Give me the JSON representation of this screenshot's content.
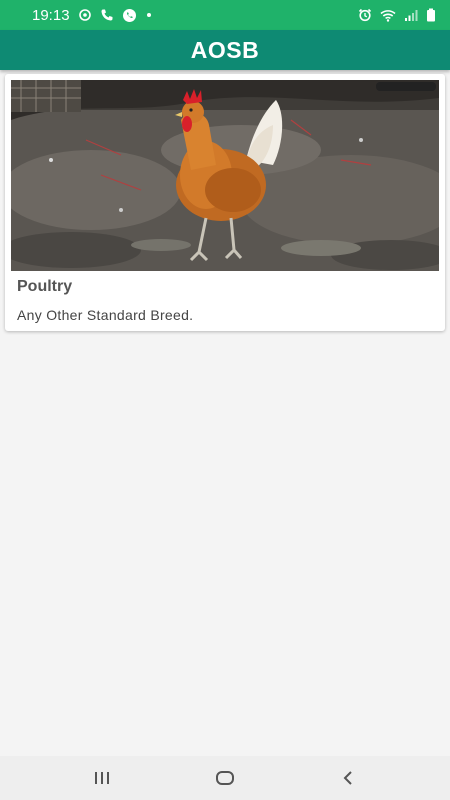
{
  "status_bar": {
    "time": "19:13",
    "left_icons": [
      "sync-icon",
      "phone-icon",
      "whatsapp-icon",
      "dot-icon"
    ],
    "right_icons": [
      "alarm-icon",
      "wifi-icon",
      "signal-icon",
      "battery-icon"
    ],
    "color": "#1fb26a"
  },
  "app_bar": {
    "title": "AOSB",
    "color": "#0e8a73"
  },
  "card": {
    "image_icon": "rooster-photo",
    "title": "Poultry",
    "subtitle": "Any Other Standard Breed."
  },
  "nav_bar": {
    "buttons": [
      "recent-apps-icon",
      "home-icon",
      "back-icon"
    ]
  }
}
